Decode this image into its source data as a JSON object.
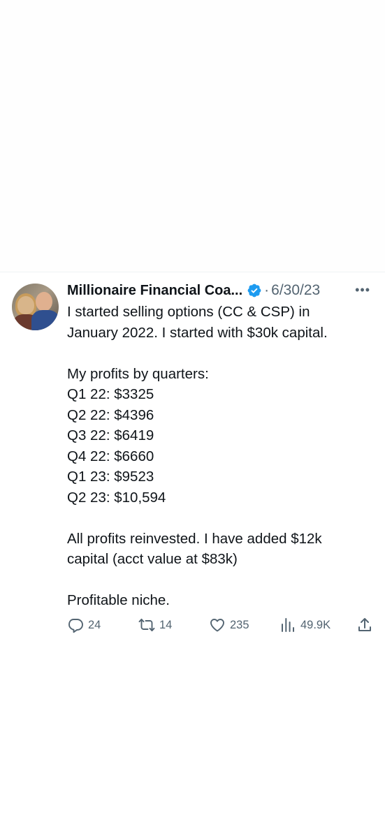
{
  "tweet": {
    "display_name": "Millionaire Financial Coa...",
    "separator": "·",
    "date": "6/30/23",
    "more_label": "•••",
    "lines": [
      "I started selling options (CC & CSP) in",
      "January 2022. I started with $30k capital.",
      "",
      "My profits by quarters:",
      "Q1 22: $3325",
      "Q2 22: $4396",
      "Q3 22: $6419",
      "Q4 22: $6660",
      "Q1 23: $9523",
      "Q2 23: $10,594",
      "",
      "All profits reinvested. I have added $12k",
      "capital (acct value at $83k)",
      "",
      "Profitable niche."
    ],
    "actions": {
      "replies": "24",
      "retweets": "14",
      "likes": "235",
      "views": "49.9K"
    },
    "icons": {
      "avatar": "profile-photo",
      "verified": "verified-badge-icon",
      "reply": "reply-icon",
      "retweet": "retweet-icon",
      "like": "heart-icon",
      "views": "views-chart-icon",
      "share": "share-icon"
    },
    "colors": {
      "verified": "#1d9bf0",
      "muted": "#536471",
      "text": "#0f1419",
      "divider": "#eff3f4"
    }
  }
}
